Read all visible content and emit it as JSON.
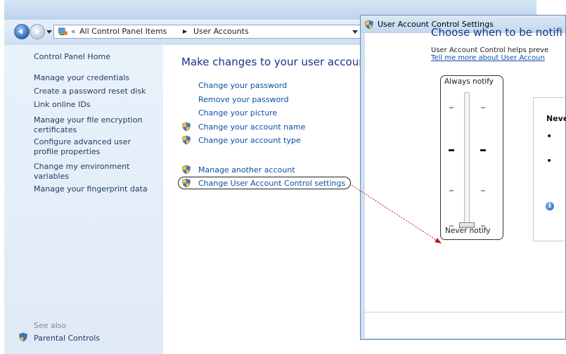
{
  "explorer": {
    "address_separator": "«",
    "breadcrumbs": [
      "All Control Panel Items",
      "User Accounts"
    ],
    "crumb_arrow": "▶"
  },
  "sidebar": {
    "items": [
      "Control Panel Home",
      "Manage your credentials",
      "Create a password reset disk",
      "Link online IDs",
      "Manage your file encryption certificates",
      "Configure advanced user profile properties",
      "Change my environment variables",
      "Manage your fingerprint data"
    ],
    "see_also_label": "See also",
    "see_also_items": [
      "Parental Controls"
    ]
  },
  "main": {
    "heading": "Make changes to your user accour",
    "links": [
      "Change your password",
      "Remove your password",
      "Change your picture",
      "Change your account name",
      "Change your account type",
      "Manage another account",
      "Change User Account Control settings"
    ]
  },
  "uac_dialog": {
    "title": "User Account Control Settings",
    "heading": "Choose when to be notifi",
    "description": "User Account Control helps preve",
    "learn_more": "Tell me more about User Accoun",
    "slider": {
      "top_label": "Always notify",
      "bottom_label": "Never notify",
      "position": 0,
      "levels": 4
    },
    "level_title": "Neve",
    "bullets": [
      "•",
      "•"
    ],
    "info_glyph": "i"
  },
  "colors": {
    "link": "#0a4fa6",
    "heading": "#1e3287",
    "sidebar_bg": "#e3edf8",
    "annotation_arrow": "#c01818"
  }
}
